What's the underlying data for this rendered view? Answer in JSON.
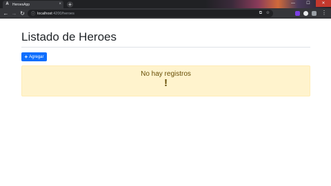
{
  "browser": {
    "tab": {
      "favicon": "A",
      "title": "HeroesApp",
      "close_glyph": "×"
    },
    "new_tab_glyph": "+",
    "window_controls": {
      "minimize": "—",
      "maximize": "☐",
      "close": "✕"
    },
    "nav": {
      "back": "←",
      "forward": "→",
      "reload": "↻"
    },
    "address_bar": {
      "info_icon": "ⓘ",
      "host": "localhost",
      "path": ":4200/heroes",
      "translate_icon": "⧉",
      "star_icon": "☆"
    },
    "menu_glyph": "⋮"
  },
  "page": {
    "title": "Listado de Heroes",
    "add_button": {
      "icon": "+",
      "label": "Agregar"
    },
    "alert": {
      "message": "No hay registros",
      "icon": "!"
    }
  },
  "colors": {
    "primary": "#0d6efd",
    "alert_bg": "#fff3cd",
    "alert_text": "#664d03"
  }
}
